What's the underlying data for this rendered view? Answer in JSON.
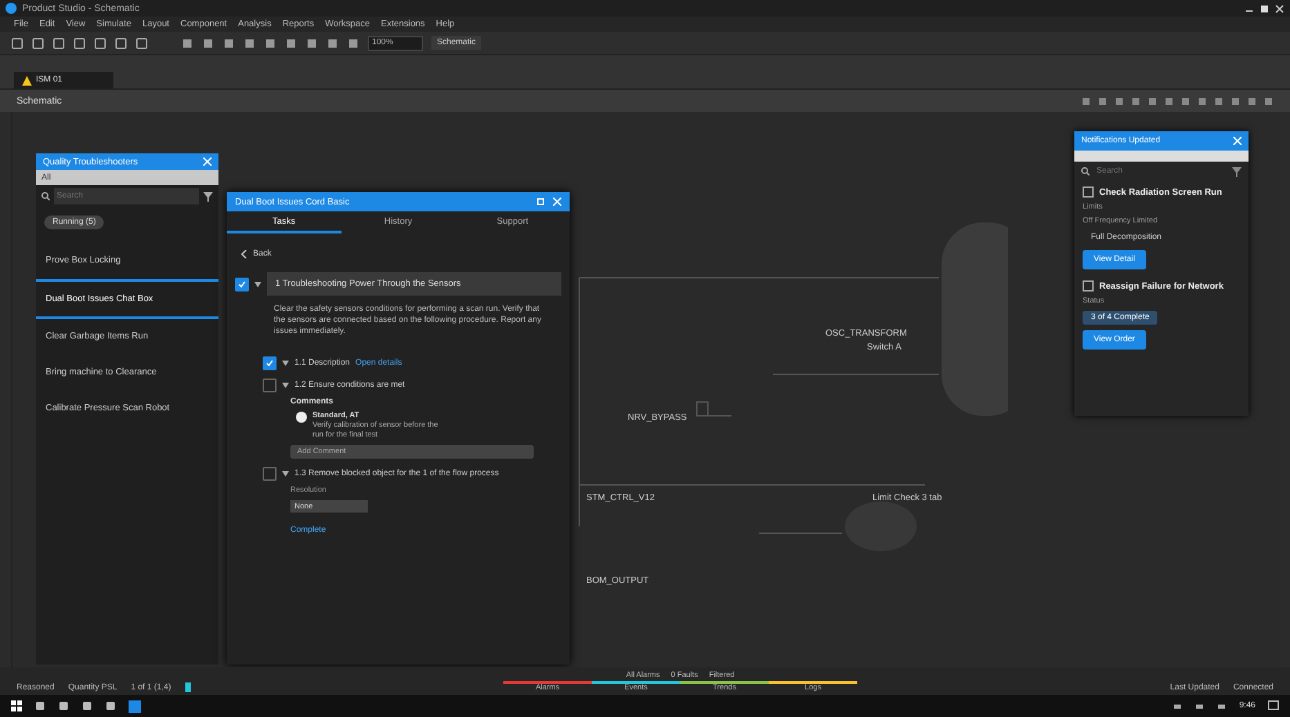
{
  "window": {
    "title": "Product Studio - Schematic"
  },
  "menu": [
    "File",
    "Edit",
    "View",
    "Simulate",
    "Layout",
    "Component",
    "Analysis",
    "Reports",
    "Workspace",
    "Extensions",
    "Help"
  ],
  "toolbar": {
    "zoom_value": "100%",
    "mode_button": "Schematic"
  },
  "document_tab": {
    "label": "ISM 01"
  },
  "section_title": "Schematic",
  "left_panel": {
    "title": "Quality Troubleshooters",
    "filter": "All",
    "search_placeholder": "Search",
    "tag": "Running (5)",
    "items": [
      {
        "label": "Prove Box Locking",
        "selected": false
      },
      {
        "label": "Dual Boot Issues Chat Box",
        "selected": true
      },
      {
        "label": "Clear Garbage Items Run",
        "selected": false
      },
      {
        "label": "Bring machine to Clearance",
        "selected": false
      },
      {
        "label": "Calibrate Pressure Scan Robot",
        "selected": false
      }
    ]
  },
  "task_panel": {
    "title": "Dual Boot Issues Cord Basic",
    "tabs": [
      {
        "label": "Tasks",
        "selected": true
      },
      {
        "label": "History",
        "selected": false
      },
      {
        "label": "Support",
        "selected": false
      }
    ],
    "back": "Back",
    "step": {
      "label": "1 Troubleshooting Power Through the Sensors",
      "checked": true,
      "description": "Clear the safety sensors conditions for performing a scan run. Verify that the sensors are connected based on the following procedure. Report any issues immediately."
    },
    "substeps": [
      {
        "kind": "link",
        "label": "1.1 Description",
        "checked": true,
        "link": "Open details"
      },
      {
        "kind": "comment",
        "label": "1.2 Ensure conditions are met",
        "checked": false,
        "heading": "Comments",
        "author": "Standard, AT",
        "comment": "Verify calibration of sensor before the",
        "comment_2": "run for the final test",
        "input_placeholder": "Add Comment"
      },
      {
        "kind": "select",
        "label": "1.3 Remove blocked object for the 1 of the flow process",
        "checked": false,
        "field_label": "Resolution",
        "value": "None",
        "link": "Complete"
      }
    ]
  },
  "right_panel": {
    "title": "Notifications Updated",
    "search_placeholder": "Search",
    "cards": [
      {
        "title": "Check Radiation Screen Run",
        "field_label": "Limits",
        "field_label_2": "Off Frequency Limited",
        "value": "Full Decomposition",
        "button": "View Detail"
      },
      {
        "title": "Reassign Failure for Network",
        "field_label": "Status",
        "value": "3 of 4 Complete",
        "button": "View Order"
      }
    ]
  },
  "diagram": {
    "labels": [
      "OSC_TRANSFORM",
      "Switch A",
      "NRV_BYPASS",
      "STM_CTRL_V12",
      "Limit Check 3 tab",
      "BOM_OUTPUT"
    ]
  },
  "status_bar": {
    "left": [
      "Reasoned",
      "Quantity PSL",
      "1 of 1 (1,4)"
    ],
    "center": [
      "All Alarms",
      "0 Faults",
      "Filtered"
    ],
    "tabs": [
      {
        "label": "Alarms",
        "color": "#e53935"
      },
      {
        "label": "Events",
        "color": "#26c6da"
      },
      {
        "label": "Trends",
        "color": "#8bc34a"
      },
      {
        "label": "Logs",
        "color": "#fbc02d"
      }
    ],
    "right": [
      "Last Updated",
      "Connected"
    ]
  },
  "taskbar": {
    "time": "9:46"
  }
}
